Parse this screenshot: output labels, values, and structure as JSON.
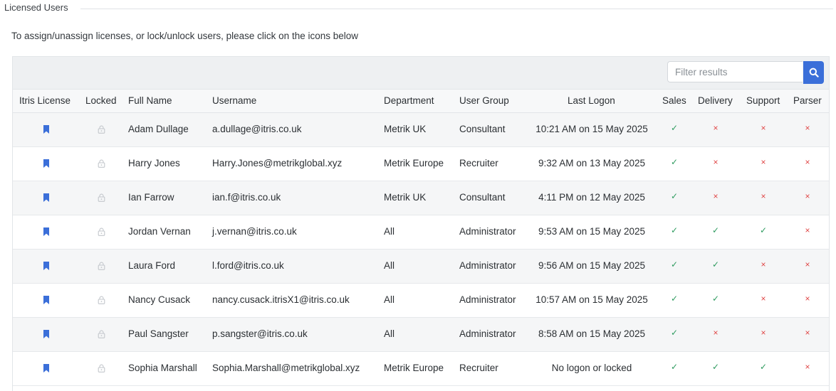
{
  "section": {
    "title": "Licensed Users",
    "instructions": "To assign/unassign licenses, or lock/unlock users, please click on the icons below"
  },
  "filter": {
    "placeholder": "Filter results",
    "search_icon": "search-icon"
  },
  "columns": {
    "license": "Itris License",
    "locked": "Locked",
    "full_name": "Full Name",
    "username": "Username",
    "department": "Department",
    "user_group": "User Group",
    "last_logon": "Last Logon",
    "sales": "Sales",
    "delivery": "Delivery",
    "support": "Support",
    "parser": "Parser"
  },
  "icons": {
    "license": "bookmark-icon",
    "locked": "lock-icon",
    "yes": "✓",
    "no": "×"
  },
  "colors": {
    "accent": "#3b6fd9",
    "yes": "#2e9b5f",
    "no": "#e04848"
  },
  "users": [
    {
      "full_name": "Adam Dullage",
      "username": "a.dullage@itris.co.uk",
      "department": "Metrik UK",
      "user_group": "Consultant",
      "last_logon": "10:21 AM on 15 May 2025",
      "sales": true,
      "delivery": false,
      "support": false,
      "parser": false
    },
    {
      "full_name": "Harry Jones",
      "username": "Harry.Jones@metrikglobal.xyz",
      "department": "Metrik Europe",
      "user_group": "Recruiter",
      "last_logon": "9:32 AM on 13 May 2025",
      "sales": true,
      "delivery": false,
      "support": false,
      "parser": false
    },
    {
      "full_name": "Ian Farrow",
      "username": "ian.f@itris.co.uk",
      "department": "Metrik UK",
      "user_group": "Consultant",
      "last_logon": "4:11 PM on 12 May 2025",
      "sales": true,
      "delivery": false,
      "support": false,
      "parser": false
    },
    {
      "full_name": "Jordan Vernan",
      "username": "j.vernan@itris.co.uk",
      "department": "All",
      "user_group": "Administrator",
      "last_logon": "9:53 AM on 15 May 2025",
      "sales": true,
      "delivery": true,
      "support": true,
      "parser": false
    },
    {
      "full_name": "Laura Ford",
      "username": "l.ford@itris.co.uk",
      "department": "All",
      "user_group": "Administrator",
      "last_logon": "9:56 AM on 15 May 2025",
      "sales": true,
      "delivery": true,
      "support": false,
      "parser": false
    },
    {
      "full_name": "Nancy Cusack",
      "username": "nancy.cusack.itrisX1@itris.co.uk",
      "department": "All",
      "user_group": "Administrator",
      "last_logon": "10:57 AM on 15 May 2025",
      "sales": true,
      "delivery": true,
      "support": false,
      "parser": false
    },
    {
      "full_name": "Paul Sangster",
      "username": "p.sangster@itris.co.uk",
      "department": "All",
      "user_group": "Administrator",
      "last_logon": "8:58 AM on 15 May 2025",
      "sales": true,
      "delivery": false,
      "support": false,
      "parser": false
    },
    {
      "full_name": "Sophia Marshall",
      "username": "Sophia.Marshall@metrikglobal.xyz",
      "department": "Metrik Europe",
      "user_group": "Recruiter",
      "last_logon": "No logon or locked",
      "sales": true,
      "delivery": true,
      "support": true,
      "parser": false
    }
  ]
}
